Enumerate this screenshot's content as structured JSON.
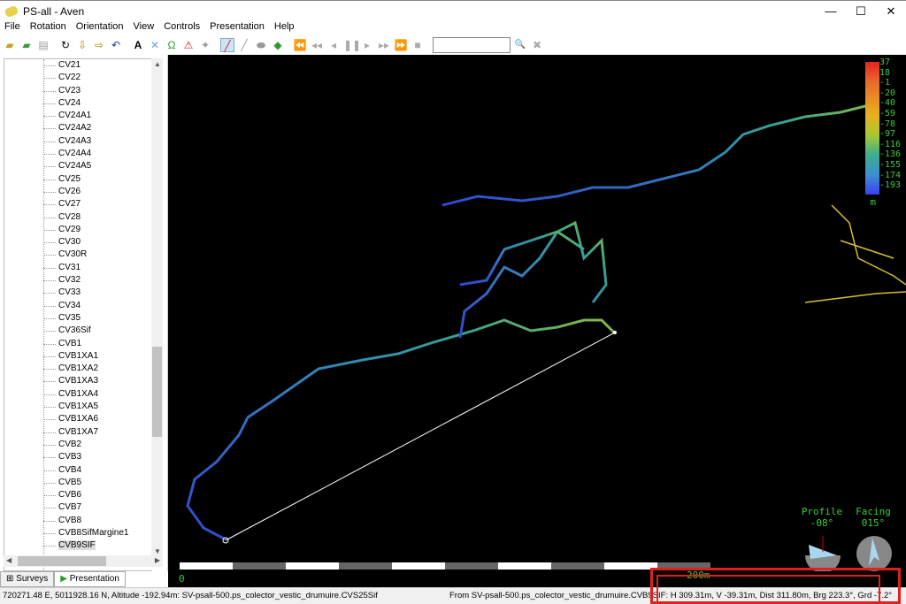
{
  "window": {
    "title": "PS-all - Aven",
    "minimize": "—",
    "maximize": "☐",
    "close": "✕"
  },
  "menu": [
    "File",
    "Rotation",
    "Orientation",
    "View",
    "Controls",
    "Presentation",
    "Help"
  ],
  "toolbar": {
    "icons": [
      "open-icon",
      "open-extra-icon",
      "print-icon",
      "rotate-icon",
      "down-arrow-icon",
      "right-arrow-icon",
      "undo-icon",
      "text-icon",
      "cross-icon",
      "omega-icon",
      "warning-icon",
      "cursor-icon",
      "pen-icon",
      "pencil-icon",
      "eraser-icon",
      "leaf-icon",
      "fast-rewind-icon",
      "rewind-icon",
      "step-back-icon",
      "pause-icon",
      "play-icon",
      "forward-icon",
      "fast-forward-icon",
      "stop-icon"
    ],
    "search_value": "",
    "search_icon": "🔍",
    "clear_icon": "✖"
  },
  "tree": {
    "items": [
      "CV21",
      "CV22",
      "CV23",
      "CV24",
      "CV24A1",
      "CV24A2",
      "CV24A3",
      "CV24A4",
      "CV24A5",
      "CV25",
      "CV26",
      "CV27",
      "CV28",
      "CV29",
      "CV30",
      "CV30R",
      "CV31",
      "CV32",
      "CV33",
      "CV34",
      "CV35",
      "CV36Sif",
      "CVB1",
      "CVB1XA1",
      "CVB1XA2",
      "CVB1XA3",
      "CVB1XA4",
      "CVB1XA5",
      "CVB1XA6",
      "CVB1XA7",
      "CVB2",
      "CVB3",
      "CVB4",
      "CVB5",
      "CVB6",
      "CVB7",
      "CVB8",
      "CVB8SifMargine1",
      "CVB9SIF"
    ],
    "selected": "CVB9SIF"
  },
  "tabs": [
    {
      "label": "Surveys"
    },
    {
      "label": "Presentation"
    }
  ],
  "legend": {
    "values": [
      "37",
      "18",
      "-1",
      "-20",
      "-40",
      "-59",
      "-78",
      "-97",
      "-116",
      "-136",
      "-155",
      "-174",
      "-193"
    ],
    "unit": "m"
  },
  "indicators": {
    "profile_label": "Profile",
    "profile_value": "-08°",
    "facing_label": "Facing",
    "facing_value": "015°"
  },
  "scale": {
    "start": "0",
    "end": "200m"
  },
  "status": {
    "left": "720271.48 E, 5011928.16 N, Altitude -192.94m: SV-psall-500.ps_colector_vestic_drumuire.CVS25Sif",
    "right": "From SV-psall-500.ps_colector_vestic_drumuire.CVB9SIF: H 309.31m, V -39.31m, Dist 311.80m, Brg 223.3°, Grd -7.2°"
  },
  "colors": {
    "highlight": "#e02020",
    "text_green": "#3dcc3d"
  }
}
